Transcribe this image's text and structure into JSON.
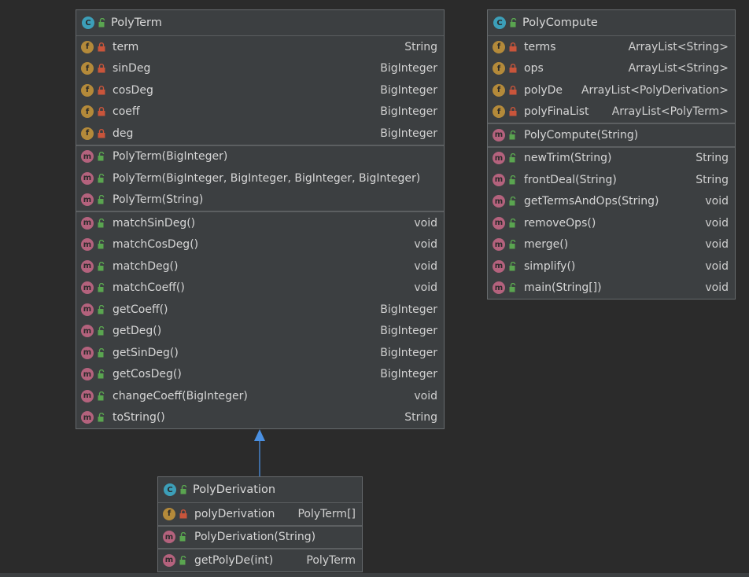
{
  "classes": [
    {
      "name": "PolyTerm",
      "kind": "class",
      "fields": [
        {
          "name": "term",
          "type": "String"
        },
        {
          "name": "sinDeg",
          "type": "BigInteger"
        },
        {
          "name": "cosDeg",
          "type": "BigInteger"
        },
        {
          "name": "coeff",
          "type": "BigInteger"
        },
        {
          "name": "deg",
          "type": "BigInteger"
        }
      ],
      "constructors": [
        {
          "name": "PolyTerm(BigInteger)",
          "type": ""
        },
        {
          "name": "PolyTerm(BigInteger, BigInteger, BigInteger, BigInteger)",
          "type": ""
        },
        {
          "name": "PolyTerm(String)",
          "type": ""
        }
      ],
      "methods": [
        {
          "name": "matchSinDeg()",
          "type": "void"
        },
        {
          "name": "matchCosDeg()",
          "type": "void"
        },
        {
          "name": "matchDeg()",
          "type": "void"
        },
        {
          "name": "matchCoeff()",
          "type": "void"
        },
        {
          "name": "getCoeff()",
          "type": "BigInteger"
        },
        {
          "name": "getDeg()",
          "type": "BigInteger"
        },
        {
          "name": "getSinDeg()",
          "type": "BigInteger"
        },
        {
          "name": "getCosDeg()",
          "type": "BigInteger"
        },
        {
          "name": "changeCoeff(BigInteger)",
          "type": "void"
        },
        {
          "name": "toString()",
          "type": "String"
        }
      ]
    },
    {
      "name": "PolyCompute",
      "kind": "class",
      "fields": [
        {
          "name": "terms",
          "type": "ArrayList<String>"
        },
        {
          "name": "ops",
          "type": "ArrayList<String>"
        },
        {
          "name": "polyDe",
          "type": "ArrayList<PolyDerivation>"
        },
        {
          "name": "polyFinaList",
          "type": "ArrayList<PolyTerm>"
        }
      ],
      "constructors": [
        {
          "name": "PolyCompute(String)",
          "type": ""
        }
      ],
      "methods": [
        {
          "name": "newTrim(String)",
          "type": "String"
        },
        {
          "name": "frontDeal(String)",
          "type": "String"
        },
        {
          "name": "getTermsAndOps(String)",
          "type": "void"
        },
        {
          "name": "removeOps()",
          "type": "void"
        },
        {
          "name": "merge()",
          "type": "void"
        },
        {
          "name": "simplify()",
          "type": "void"
        },
        {
          "name": "main(String[])",
          "type": "void"
        }
      ]
    },
    {
      "name": "PolyDerivation",
      "kind": "class",
      "fields": [
        {
          "name": "polyDerivation",
          "type": "PolyTerm[]"
        }
      ],
      "constructors": [
        {
          "name": "PolyDerivation(String)",
          "type": ""
        }
      ],
      "methods": [
        {
          "name": "getPolyDe(int)",
          "type": "PolyTerm"
        }
      ]
    }
  ],
  "relations": [
    {
      "from": "PolyDerivation",
      "to": "PolyTerm",
      "type": "inheritance"
    }
  ],
  "icons": {
    "class_badge": "c-class-icon",
    "field_badge": "f-field-icon",
    "method_badge": "m-method-icon",
    "private": "lock-icon",
    "public": "unlock-icon"
  },
  "colors": {
    "background": "#2b2b2b",
    "panel": "#3c3f41",
    "field_badge": "#b48a3a",
    "method_badge": "#b4627d",
    "class_badge": "#3c9fb9",
    "private_lock": "#c9553b",
    "public_lock": "#5aa550",
    "arrow": "#4a90e2"
  }
}
